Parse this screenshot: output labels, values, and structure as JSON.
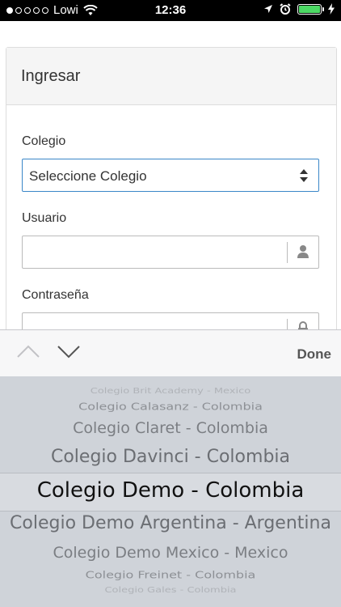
{
  "status_bar": {
    "carrier": "Lowi",
    "time": "12:36",
    "signal_filled": 1,
    "signal_total": 5,
    "battery_color": "#4cd964"
  },
  "panel": {
    "title": "Ingresar"
  },
  "form": {
    "colegio_label": "Colegio",
    "colegio_value": "Seleccione Colegio",
    "usuario_label": "Usuario",
    "usuario_value": "",
    "password_label": "Contraseña",
    "password_value": ""
  },
  "accessory": {
    "done_label": "Done"
  },
  "picker": {
    "options": [
      "Colegio Brit Academy - Mexico",
      "Colegio Calasanz - Colombia",
      "Colegio Claret - Colombia",
      "Colegio Davinci - Colombia",
      "Colegio Demo - Colombia",
      "Colegio Demo Argentina - Argentina",
      "Colegio Demo Mexico - Mexico",
      "Colegio Freinet - Colombia",
      "Colegio Gales - Colombia"
    ],
    "selected_index": 4
  },
  "colors": {
    "focus_border": "#3a87c8",
    "picker_bg": "#cfd3d9"
  }
}
